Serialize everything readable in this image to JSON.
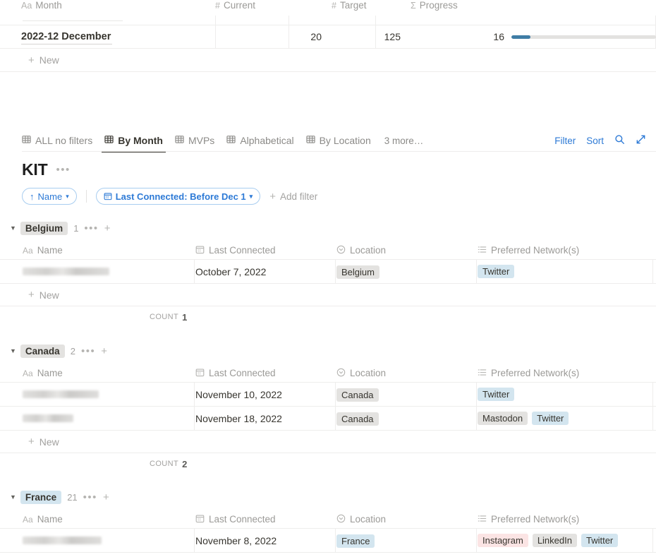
{
  "top_table": {
    "columns": [
      {
        "icon": "text-property-icon",
        "glyph": "Aa",
        "label": "Month"
      },
      {
        "icon": "number-property-icon",
        "glyph": "#",
        "label": "Current"
      },
      {
        "icon": "number-property-icon",
        "glyph": "#",
        "label": "Target"
      },
      {
        "icon": "rollup-property-icon",
        "glyph": "Σ",
        "label": "Progress"
      }
    ],
    "row": {
      "month": "2022-12 December",
      "current": "20",
      "target": "125",
      "progress_value": "16",
      "progress_percent": 13,
      "progress_fill_color": "#3f7da5",
      "progress_track_color": "#e3e2e0"
    },
    "new_label": "New"
  },
  "tabs": {
    "items": [
      {
        "label": "ALL no filters",
        "active": false
      },
      {
        "label": "By Month",
        "active": true
      },
      {
        "label": "MVPs",
        "active": false
      },
      {
        "label": "Alphabetical",
        "active": false
      },
      {
        "label": "By Location",
        "active": false
      }
    ],
    "more_label": "3 more…",
    "filter_label": "Filter",
    "sort_label": "Sort",
    "accent_color": "#2d7ad6"
  },
  "header": {
    "title": "KIT",
    "menu_glyph": "•••"
  },
  "filters": {
    "sort_chip": {
      "label": "Name",
      "arrow": "↑",
      "chevron": "⌄"
    },
    "filter_chip": {
      "label": "Last Connected: Before Dec 1",
      "chevron": "⌄"
    },
    "add_filter_label": "Add filter"
  },
  "table_columns": [
    {
      "icon": "text-property-icon",
      "glyph": "Aa",
      "label": "Name"
    },
    {
      "icon": "date-property-icon",
      "glyph": "",
      "label": "Last Connected"
    },
    {
      "icon": "select-property-icon",
      "glyph": "",
      "label": "Location"
    },
    {
      "icon": "multi-select-property-icon",
      "glyph": "",
      "label": "Preferred Network(s)"
    }
  ],
  "new_row_label": "New",
  "count_label": "COUNT",
  "groups": [
    {
      "name": "Belgium",
      "tag_color": "gray",
      "count": "1",
      "count_footer": "1",
      "rows": [
        {
          "name_redacted": true,
          "redact_width": 123,
          "last_connected": "October 7, 2022",
          "location": {
            "label": "Belgium",
            "color": "gray"
          },
          "networks": [
            {
              "label": "Twitter",
              "color": "blue"
            }
          ]
        }
      ]
    },
    {
      "name": "Canada",
      "tag_color": "gray",
      "count": "2",
      "count_footer": "2",
      "rows": [
        {
          "name_redacted": true,
          "redact_width": 108,
          "last_connected": "November 10, 2022",
          "location": {
            "label": "Canada",
            "color": "gray"
          },
          "networks": [
            {
              "label": "Twitter",
              "color": "blue"
            }
          ]
        },
        {
          "name_redacted": true,
          "redact_width": 72,
          "last_connected": "November 18, 2022",
          "location": {
            "label": "Canada",
            "color": "gray"
          },
          "networks": [
            {
              "label": "Mastodon",
              "color": "gray"
            },
            {
              "label": "Twitter",
              "color": "blue"
            }
          ]
        }
      ]
    },
    {
      "name": "France",
      "tag_color": "blue",
      "count": "21",
      "count_footer": null,
      "rows": [
        {
          "name_redacted": true,
          "redact_width": 112,
          "last_connected": "November 8, 2022",
          "location": {
            "label": "France",
            "color": "blue"
          },
          "networks": [
            {
              "label": "Instagram",
              "color": "red"
            },
            {
              "label": "LinkedIn",
              "color": "gray"
            },
            {
              "label": "Twitter",
              "color": "blue"
            }
          ]
        }
      ]
    }
  ],
  "colors": {
    "tag_gray": "#e3e2e0",
    "tag_blue": "#d3e5ef",
    "tag_red": "#fbe4e4",
    "accent": "#2d7ad6",
    "text": "#37352f",
    "muted": "#9b9a97"
  }
}
